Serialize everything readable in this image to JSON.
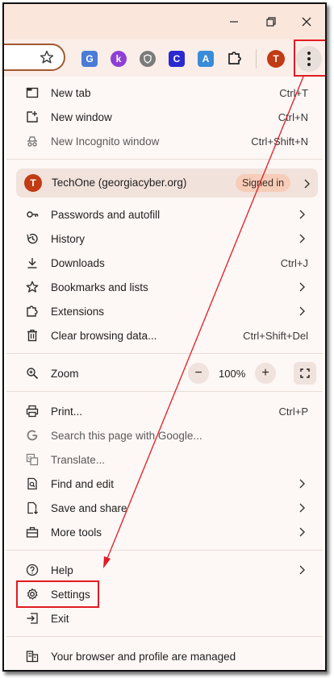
{
  "window": {
    "minimize_icon": "minimize-icon",
    "restore_icon": "restore-icon",
    "close_icon": "close-icon"
  },
  "toolbar": {
    "bookmark_icon": "star-icon",
    "extensions": [
      {
        "name": "translate-extension-icon",
        "color": "#4a7bd6",
        "glyph": "G"
      },
      {
        "name": "k-extension-icon",
        "color": "#8e3fd6",
        "glyph": "k"
      },
      {
        "name": "shield-extension-icon",
        "color": "#7b7b7b",
        "glyph": ""
      },
      {
        "name": "c-extension-icon",
        "color": "#2a2ad0",
        "glyph": "C"
      },
      {
        "name": "translate-a-extension-icon",
        "color": "#3a8bd8",
        "glyph": "A"
      }
    ],
    "profile_avatar": "T",
    "menu_icon": "more-vert-icon"
  },
  "menu": {
    "new_tab": {
      "label": "New tab",
      "shortcut": "Ctrl+T"
    },
    "new_window": {
      "label": "New window",
      "shortcut": "Ctrl+N"
    },
    "new_incognito": {
      "label": "New Incognito window",
      "shortcut": "Ctrl+Shift+N"
    },
    "profile": {
      "avatar": "T",
      "label": "TechOne (georgiacyber.org)",
      "badge": "Signed in"
    },
    "passwords": {
      "label": "Passwords and autofill"
    },
    "history": {
      "label": "History"
    },
    "downloads": {
      "label": "Downloads",
      "shortcut": "Ctrl+J"
    },
    "bookmarks": {
      "label": "Bookmarks and lists"
    },
    "extensions": {
      "label": "Extensions"
    },
    "clear_data": {
      "label": "Clear browsing data...",
      "shortcut": "Ctrl+Shift+Del"
    },
    "zoom": {
      "label": "Zoom",
      "minus": "−",
      "value": "100%",
      "plus": "+"
    },
    "print": {
      "label": "Print...",
      "shortcut": "Ctrl+P"
    },
    "search_google": {
      "label": "Search this page with Google..."
    },
    "translate": {
      "label": "Translate..."
    },
    "find_edit": {
      "label": "Find and edit"
    },
    "save_share": {
      "label": "Save and share"
    },
    "more_tools": {
      "label": "More tools"
    },
    "help": {
      "label": "Help"
    },
    "settings": {
      "label": "Settings"
    },
    "exit": {
      "label": "Exit"
    },
    "managed": {
      "label": "Your browser and profile are managed"
    }
  },
  "colors": {
    "accent_red": "#e11b22",
    "menu_bg": "#fdf7f5",
    "avatar": "#c13b14"
  }
}
